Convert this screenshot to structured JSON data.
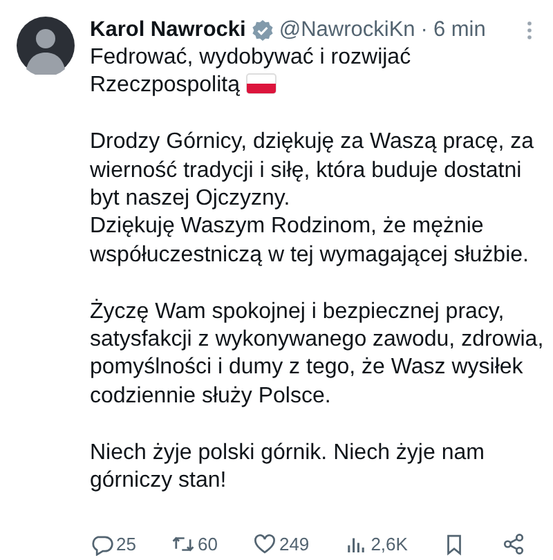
{
  "tweet": {
    "author": "Karol Nawrocki",
    "verified": true,
    "handle": "@NawrockiKn",
    "separator": "·",
    "time": "6 min",
    "headline": "Fedrować, wydobywać i rozwijać Rzeczpospolitą",
    "paragraphs": [
      "Drodzy Górnicy, dziękuję za Waszą pracę, za wierność tradycji i siłę, która buduje dostatni byt naszej Ojczyzny.\nDziękuję Waszym Rodzinom, że mężnie współuczestniczą w tej wymagającej służbie.",
      "Życzę Wam spokojnej i bezpiecznej pracy, satysfakcji z wykonywanego zawodu, zdrowia, pomyślności i dumy z tego, że Wasz wysiłek codziennie służy Polsce.",
      "Niech żyje polski górnik. Niech żyje nam górniczy stan!"
    ],
    "actions": [
      {
        "kind": "reply",
        "count": "25"
      },
      {
        "kind": "repost",
        "count": "60"
      },
      {
        "kind": "like",
        "count": "249"
      },
      {
        "kind": "views",
        "count": "2,6K"
      },
      {
        "kind": "bookmark"
      },
      {
        "kind": "share"
      }
    ]
  }
}
